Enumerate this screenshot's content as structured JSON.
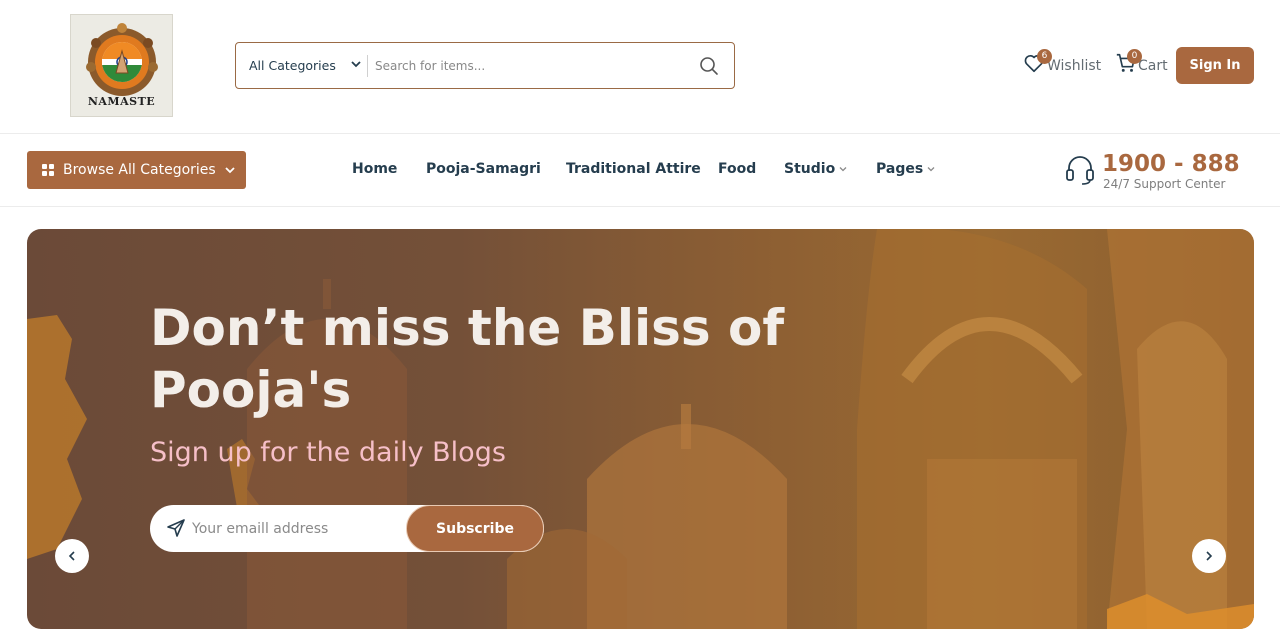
{
  "logo": {
    "text": "NAMASTE"
  },
  "search": {
    "category": "All Categories",
    "placeholder": "Search for items..."
  },
  "header_actions": {
    "wishlist_label": "Wishlist",
    "wishlist_count": "6",
    "cart_label": "Cart",
    "cart_count": "0",
    "signin_label": "Sign In"
  },
  "nav": {
    "browse_label": "Browse All Categories",
    "items": [
      {
        "label": "Home"
      },
      {
        "label": "Pooja-Samagri"
      },
      {
        "label": "Traditional Attire"
      },
      {
        "label": "Food"
      },
      {
        "label": "Studio"
      },
      {
        "label": "Pages"
      }
    ]
  },
  "support": {
    "number": "1900 - 888",
    "subtitle": "24/7 Support Center"
  },
  "hero": {
    "title": "Don’t miss the Bliss of Pooja's",
    "subtitle": "Sign up for the daily Blogs",
    "email_placeholder": "Your emaill address",
    "subscribe_label": "Subscribe"
  },
  "colors": {
    "accent": "#a9683f",
    "text": "#253d4e",
    "hero_subtitle": "#f6bfc8"
  }
}
